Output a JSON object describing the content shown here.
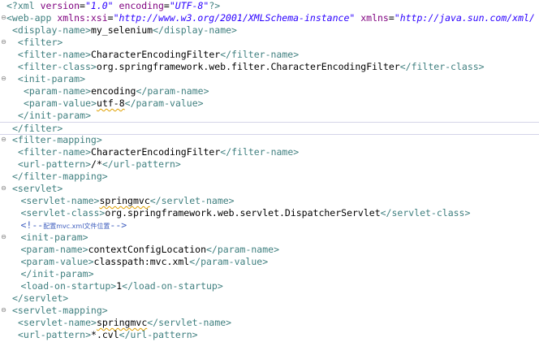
{
  "editor": {
    "lines": [
      {
        "indent": 0,
        "fold": "",
        "tokens": [
          {
            "t": "<?",
            "c": "pi"
          },
          {
            "t": "xml",
            "c": "pi"
          },
          {
            "t": " version",
            "c": "attr"
          },
          {
            "t": "=",
            "c": "text"
          },
          {
            "t": "\"1.0\"",
            "c": "val"
          },
          {
            "t": " encoding",
            "c": "attr"
          },
          {
            "t": "=",
            "c": "text"
          },
          {
            "t": "\"UTF-8\"",
            "c": "val"
          },
          {
            "t": "?>",
            "c": "pi"
          }
        ]
      },
      {
        "indent": 0,
        "fold": "⊖",
        "tokens": [
          {
            "t": "<web-app",
            "c": "tag"
          },
          {
            "t": " xmlns:xsi",
            "c": "attr"
          },
          {
            "t": "=",
            "c": "text"
          },
          {
            "t": "\"http://www.w3.org/2001/XMLSchema-instance\"",
            "c": "val"
          },
          {
            "t": " xmlns",
            "c": "attr"
          },
          {
            "t": "=",
            "c": "text"
          },
          {
            "t": "\"http://java.sun.com/xml/",
            "c": "val"
          }
        ]
      },
      {
        "indent": 2,
        "fold": "",
        "tokens": [
          {
            "t": "<display-name>",
            "c": "tag"
          },
          {
            "t": "my_selenium",
            "c": "text"
          },
          {
            "t": "</display-name>",
            "c": "tag"
          }
        ]
      },
      {
        "indent": 2,
        "fold": "⊖",
        "tokens": [
          {
            "t": " <filter>",
            "c": "tag"
          }
        ]
      },
      {
        "indent": 2,
        "fold": "",
        "tokens": [
          {
            "t": " <filter-name>",
            "c": "tag"
          },
          {
            "t": "CharacterEncodingFilter",
            "c": "text"
          },
          {
            "t": "</filter-name>",
            "c": "tag"
          }
        ]
      },
      {
        "indent": 2,
        "fold": "",
        "tokens": [
          {
            "t": " <filter-class>",
            "c": "tag"
          },
          {
            "t": "org.springframework.web.filter.CharacterEncodingFilter",
            "c": "text"
          },
          {
            "t": "</filter-class>",
            "c": "tag"
          }
        ]
      },
      {
        "indent": 2,
        "fold": "⊖",
        "tokens": [
          {
            "t": " <init-param>",
            "c": "tag"
          }
        ]
      },
      {
        "indent": 6,
        "fold": "",
        "tokens": [
          {
            "t": "<param-name>",
            "c": "tag"
          },
          {
            "t": "encoding",
            "c": "text"
          },
          {
            "t": "</param-name>",
            "c": "tag"
          }
        ]
      },
      {
        "indent": 6,
        "fold": "",
        "tokens": [
          {
            "t": "<param-value>",
            "c": "tag"
          },
          {
            "t": "utf-8",
            "c": "text",
            "spell": true
          },
          {
            "t": "</param-value>",
            "c": "tag"
          }
        ]
      },
      {
        "indent": 4,
        "fold": "",
        "tokens": [
          {
            "t": "</init-param>",
            "c": "tag"
          }
        ]
      },
      {
        "indent": 2,
        "fold": "",
        "current": true,
        "tokens": [
          {
            "t": "</filter>",
            "c": "tag"
          }
        ]
      },
      {
        "indent": 2,
        "fold": "⊖",
        "tokens": [
          {
            "t": "<filter-mapping>",
            "c": "tag"
          }
        ]
      },
      {
        "indent": 4,
        "fold": "",
        "tokens": [
          {
            "t": "<filter-name>",
            "c": "tag"
          },
          {
            "t": "CharacterEncodingFilter",
            "c": "text"
          },
          {
            "t": "</filter-name>",
            "c": "tag"
          }
        ]
      },
      {
        "indent": 4,
        "fold": "",
        "tokens": [
          {
            "t": "<url-pattern>",
            "c": "tag"
          },
          {
            "t": "/*",
            "c": "text"
          },
          {
            "t": "</url-pattern>",
            "c": "tag"
          }
        ]
      },
      {
        "indent": 2,
        "fold": "",
        "tokens": [
          {
            "t": "</filter-mapping>",
            "c": "tag"
          }
        ]
      },
      {
        "indent": 2,
        "fold": "⊖",
        "tokens": [
          {
            "t": "<servlet>",
            "c": "tag"
          }
        ]
      },
      {
        "indent": 5,
        "fold": "",
        "tokens": [
          {
            "t": "<servlet-name>",
            "c": "tag"
          },
          {
            "t": "springmvc",
            "c": "text",
            "spell": true
          },
          {
            "t": "</servlet-name>",
            "c": "tag"
          }
        ]
      },
      {
        "indent": 5,
        "fold": "",
        "tokens": [
          {
            "t": "<servlet-class>",
            "c": "tag"
          },
          {
            "t": "org.springframework.web.servlet.DispatcherServlet",
            "c": "text"
          },
          {
            "t": "</servlet-class>",
            "c": "tag"
          }
        ]
      },
      {
        "indent": 5,
        "fold": "",
        "tokens": [
          {
            "t": "<!--",
            "c": "com"
          },
          {
            "t": "配置mvc.xml文件位置",
            "c": "com-cjk"
          },
          {
            "t": "-->",
            "c": "com"
          }
        ]
      },
      {
        "indent": 5,
        "fold": "⊖",
        "tokens": [
          {
            "t": "<init-param>",
            "c": "tag"
          }
        ]
      },
      {
        "indent": 5,
        "fold": "",
        "tokens": [
          {
            "t": "<param-name>",
            "c": "tag"
          },
          {
            "t": "contextConfigLocation",
            "c": "text"
          },
          {
            "t": "</param-name>",
            "c": "tag"
          }
        ]
      },
      {
        "indent": 5,
        "fold": "",
        "tokens": [
          {
            "t": "<param-value>",
            "c": "tag"
          },
          {
            "t": "classpath:mvc.xml",
            "c": "text"
          },
          {
            "t": "</param-value>",
            "c": "tag"
          }
        ]
      },
      {
        "indent": 5,
        "fold": "",
        "tokens": [
          {
            "t": "</init-param>",
            "c": "tag"
          }
        ]
      },
      {
        "indent": 5,
        "fold": "",
        "tokens": [
          {
            "t": "<load-on-startup>",
            "c": "tag"
          },
          {
            "t": "1",
            "c": "text"
          },
          {
            "t": "</load-on-startup>",
            "c": "tag"
          }
        ]
      },
      {
        "indent": 2,
        "fold": "",
        "tokens": [
          {
            "t": "</servlet>",
            "c": "tag"
          }
        ]
      },
      {
        "indent": 2,
        "fold": "⊖",
        "tokens": [
          {
            "t": "<servlet-mapping>",
            "c": "tag"
          }
        ]
      },
      {
        "indent": 4,
        "fold": "",
        "tokens": [
          {
            "t": "<servlet-name>",
            "c": "tag"
          },
          {
            "t": "springmvc",
            "c": "text",
            "spell": true
          },
          {
            "t": "</servlet-name>",
            "c": "tag"
          }
        ]
      },
      {
        "indent": 4,
        "fold": "",
        "tokens": [
          {
            "t": "<url-pattern>",
            "c": "tag"
          },
          {
            "t": "*.cvl",
            "c": "text"
          },
          {
            "t": "</url-pattern>",
            "c": "tag"
          }
        ]
      }
    ]
  },
  "colors": {
    "tag": "#3f7f7f",
    "attribute": "#7f007f",
    "attribute_value": "#2a00ff",
    "text": "#000000",
    "comment": "#3f5fbf",
    "current_line_border": "#d4d4e8",
    "spell_underline": "#e0a000"
  },
  "icons": {
    "fold": "minus-circle-icon"
  }
}
